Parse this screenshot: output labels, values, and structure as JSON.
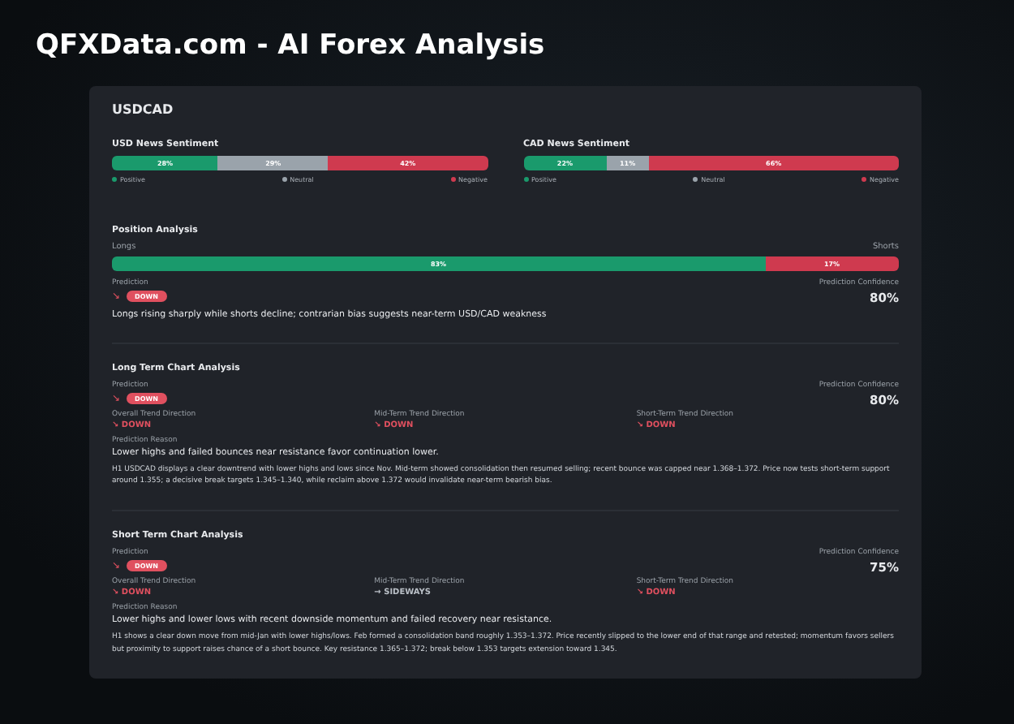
{
  "title": "QFXData.com - AI Forex Analysis",
  "pair": "USDCAD",
  "sentiment": [
    {
      "title": "USD News Sentiment",
      "segments": [
        {
          "kind": "positive",
          "label": "28%"
        },
        {
          "kind": "neutral",
          "label": "29%"
        },
        {
          "kind": "negative",
          "label": "42%"
        }
      ],
      "legend": [
        {
          "kind": "positive",
          "label": "Positive"
        },
        {
          "kind": "neutral",
          "label": "Neutral"
        },
        {
          "kind": "negative",
          "label": "Negative"
        }
      ]
    },
    {
      "title": "CAD News Sentiment",
      "segments": [
        {
          "kind": "positive",
          "label": "22%"
        },
        {
          "kind": "neutral",
          "label": "11%"
        },
        {
          "kind": "negative",
          "label": "66%"
        }
      ],
      "legend": [
        {
          "kind": "positive",
          "label": "Positive"
        },
        {
          "kind": "neutral",
          "label": "Neutral"
        },
        {
          "kind": "negative",
          "label": "Negative"
        }
      ]
    }
  ],
  "position": {
    "title": "Position Analysis",
    "left_label": "Longs",
    "right_label": "Shorts",
    "segments": [
      {
        "kind": "positive",
        "label": "83%"
      },
      {
        "kind": "negative",
        "label": "17%"
      }
    ],
    "prediction_label": "Prediction",
    "prediction": {
      "arrow": "↘",
      "badge": "DOWN",
      "kind": "down"
    },
    "confidence_label": "Prediction Confidence",
    "confidence": "80%",
    "summary": "Longs rising sharply while shorts decline; contrarian bias suggests near-term USD/CAD weakness"
  },
  "charts": [
    {
      "title": "Long Term Chart Analysis",
      "prediction_label": "Prediction",
      "prediction": {
        "arrow": "↘",
        "badge": "DOWN",
        "kind": "down"
      },
      "confidence_label": "Prediction Confidence",
      "confidence": "80%",
      "trends": [
        {
          "label": "Overall Trend Direction",
          "value": "↘ DOWN",
          "kind": "down"
        },
        {
          "label": "Mid-Term Trend Direction",
          "value": "↘ DOWN",
          "kind": "down"
        },
        {
          "label": "Short-Term Trend Direction",
          "value": "↘ DOWN",
          "kind": "down"
        }
      ],
      "reason_label": "Prediction Reason",
      "reason": "Lower highs and failed bounces near resistance favor continuation lower.",
      "details": "H1 USDCAD displays a clear downtrend with lower highs and lows since Nov. Mid-term showed consolidation then resumed selling; recent bounce was capped near 1.368–1.372. Price now tests short-term support around 1.355; a decisive break targets 1.345–1.340, while reclaim above 1.372 would invalidate near-term bearish bias."
    },
    {
      "title": "Short Term Chart Analysis",
      "prediction_label": "Prediction",
      "prediction": {
        "arrow": "↘",
        "badge": "DOWN",
        "kind": "down"
      },
      "confidence_label": "Prediction Confidence",
      "confidence": "75%",
      "trends": [
        {
          "label": "Overall Trend Direction",
          "value": "↘ DOWN",
          "kind": "down"
        },
        {
          "label": "Mid-Term Trend Direction",
          "value": "→ SIDEWAYS",
          "kind": "sideways"
        },
        {
          "label": "Short-Term Trend Direction",
          "value": "↘ DOWN",
          "kind": "down"
        }
      ],
      "reason_label": "Prediction Reason",
      "reason": "Lower highs and lower lows with recent downside momentum and failed recovery near resistance.",
      "details": "H1 shows a clear down move from mid-Jan with lower highs/lows. Feb formed a consolidation band roughly 1.353–1.372. Price recently slipped to the lower end of that range and retested; momentum favors sellers but proximity to support raises chance of a short bounce. Key resistance 1.365–1.372; break below 1.353 targets extension toward 1.345."
    }
  ]
}
